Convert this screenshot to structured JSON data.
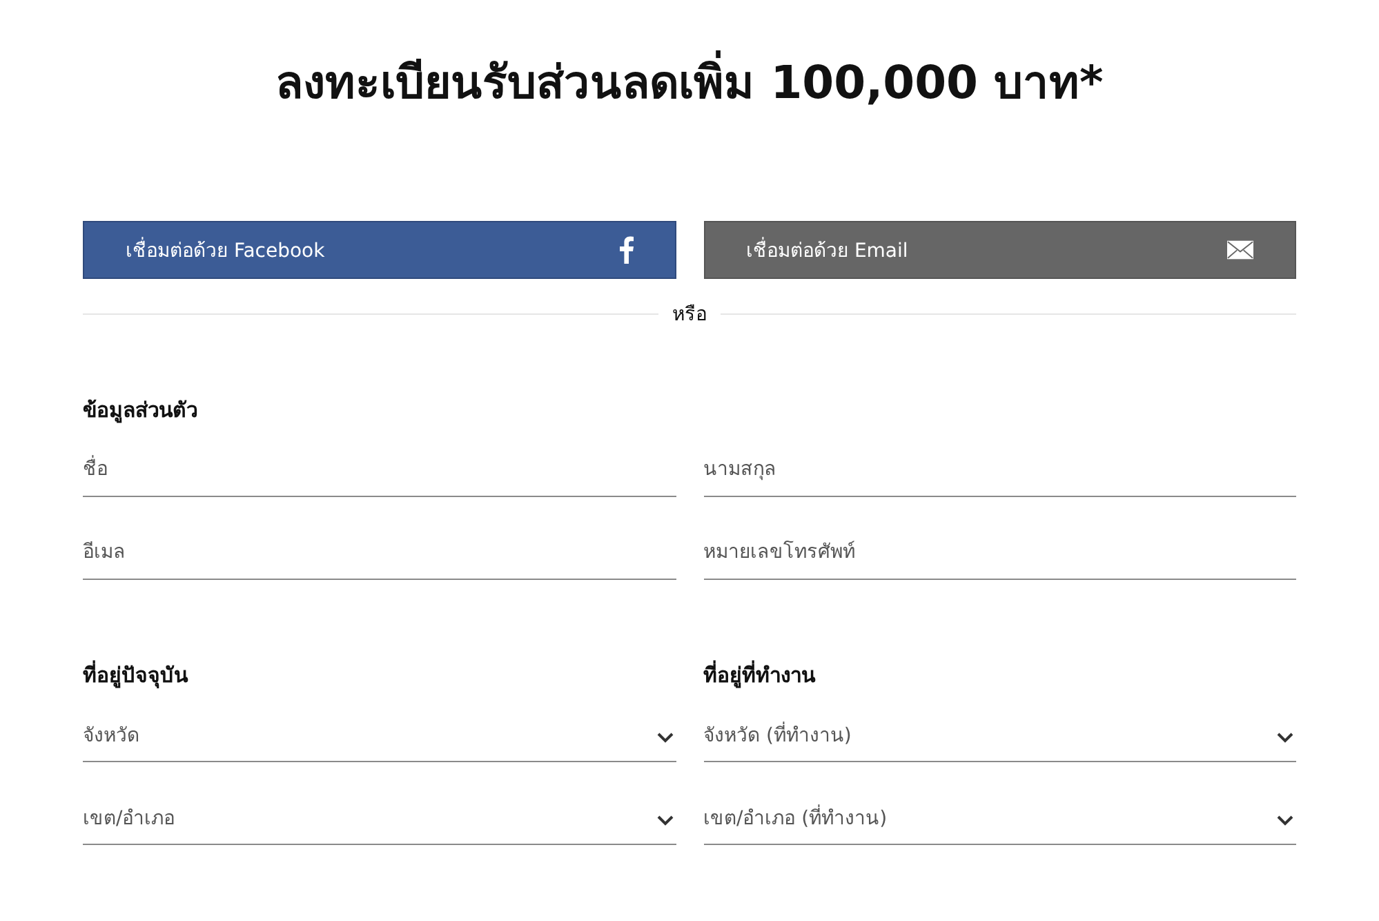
{
  "title": "ลงทะเบียนรับส่วนลดเพิ่ม 100,000 บาท*",
  "social_buttons": [
    {
      "label": "เชื่อมต่อด้วย Facebook",
      "kind": "facebook"
    },
    {
      "label": "เชื่อมต่อด้วย Email",
      "kind": "email"
    }
  ],
  "divider_text": "หรือ",
  "personal": {
    "heading": "ข้อมูลส่วนตัว",
    "fields": [
      {
        "placeholder": "ชื่อ",
        "kind": "text"
      },
      {
        "placeholder": "นามสกุล",
        "kind": "text"
      },
      {
        "placeholder": "อีเมล",
        "kind": "text"
      },
      {
        "placeholder": "หมายเลขโทรศัพท์",
        "kind": "text"
      }
    ]
  },
  "address_groups": [
    {
      "heading": "ที่อยู่ปัจจุบัน",
      "fields": [
        {
          "placeholder": "จังหวัด",
          "kind": "select"
        },
        {
          "placeholder": "เขต/อำเภอ",
          "kind": "select"
        }
      ]
    },
    {
      "heading": "ที่อยู่ที่ทำงาน",
      "fields": [
        {
          "placeholder": "จังหวัด (ที่ทำงาน)",
          "kind": "select"
        },
        {
          "placeholder": "เขต/อำเภอ (ที่ทำงาน)",
          "kind": "select"
        }
      ]
    }
  ]
}
